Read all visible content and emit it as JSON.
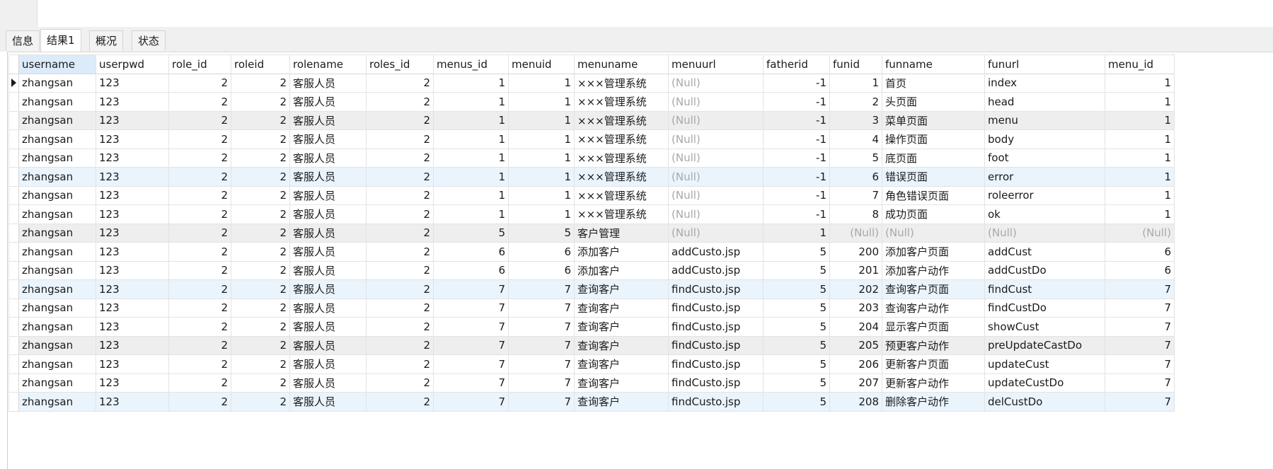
{
  "tabs": [
    {
      "label": "信息"
    },
    {
      "label": "结果1"
    },
    {
      "label": "概况"
    },
    {
      "label": "状态"
    }
  ],
  "grid": {
    "columns": [
      "username",
      "userpwd",
      "role_id",
      "roleid",
      "rolename",
      "roles_id",
      "menus_id",
      "menuid",
      "menuname",
      "menuurl",
      "fatherid",
      "funid",
      "funname",
      "funurl",
      "menu_id"
    ],
    "numeric": [
      false,
      false,
      true,
      true,
      false,
      true,
      true,
      true,
      false,
      false,
      true,
      true,
      false,
      false,
      true
    ],
    "rows": [
      [
        "zhangsan",
        "123",
        "2",
        "2",
        "客服人员",
        "2",
        "1",
        "1",
        "×××管理系统",
        "(Null)",
        "-1",
        "1",
        "首页",
        "index",
        "1"
      ],
      [
        "zhangsan",
        "123",
        "2",
        "2",
        "客服人员",
        "2",
        "1",
        "1",
        "×××管理系统",
        "(Null)",
        "-1",
        "2",
        "头页面",
        "head",
        "1"
      ],
      [
        "zhangsan",
        "123",
        "2",
        "2",
        "客服人员",
        "2",
        "1",
        "1",
        "×××管理系统",
        "(Null)",
        "-1",
        "3",
        "菜单页面",
        "menu",
        "1"
      ],
      [
        "zhangsan",
        "123",
        "2",
        "2",
        "客服人员",
        "2",
        "1",
        "1",
        "×××管理系统",
        "(Null)",
        "-1",
        "4",
        "操作页面",
        "body",
        "1"
      ],
      [
        "zhangsan",
        "123",
        "2",
        "2",
        "客服人员",
        "2",
        "1",
        "1",
        "×××管理系统",
        "(Null)",
        "-1",
        "5",
        "底页面",
        "foot",
        "1"
      ],
      [
        "zhangsan",
        "123",
        "2",
        "2",
        "客服人员",
        "2",
        "1",
        "1",
        "×××管理系统",
        "(Null)",
        "-1",
        "6",
        "错误页面",
        "error",
        "1"
      ],
      [
        "zhangsan",
        "123",
        "2",
        "2",
        "客服人员",
        "2",
        "1",
        "1",
        "×××管理系统",
        "(Null)",
        "-1",
        "7",
        "角色错误页面",
        "roleerror",
        "1"
      ],
      [
        "zhangsan",
        "123",
        "2",
        "2",
        "客服人员",
        "2",
        "1",
        "1",
        "×××管理系统",
        "(Null)",
        "-1",
        "8",
        "成功页面",
        "ok",
        "1"
      ],
      [
        "zhangsan",
        "123",
        "2",
        "2",
        "客服人员",
        "2",
        "5",
        "5",
        "客户管理",
        "(Null)",
        "1",
        "(Null)",
        "(Null)",
        "(Null)",
        "(Null)"
      ],
      [
        "zhangsan",
        "123",
        "2",
        "2",
        "客服人员",
        "2",
        "6",
        "6",
        "添加客户",
        "addCusto.jsp",
        "5",
        "200",
        "添加客户页面",
        "addCust",
        "6"
      ],
      [
        "zhangsan",
        "123",
        "2",
        "2",
        "客服人员",
        "2",
        "6",
        "6",
        "添加客户",
        "addCusto.jsp",
        "5",
        "201",
        "添加客户动作",
        "addCustDo",
        "6"
      ],
      [
        "zhangsan",
        "123",
        "2",
        "2",
        "客服人员",
        "2",
        "7",
        "7",
        "查询客户",
        "findCusto.jsp",
        "5",
        "202",
        "查询客户页面",
        "findCust",
        "7"
      ],
      [
        "zhangsan",
        "123",
        "2",
        "2",
        "客服人员",
        "2",
        "7",
        "7",
        "查询客户",
        "findCusto.jsp",
        "5",
        "203",
        "查询客户动作",
        "findCustDo",
        "7"
      ],
      [
        "zhangsan",
        "123",
        "2",
        "2",
        "客服人员",
        "2",
        "7",
        "7",
        "查询客户",
        "findCusto.jsp",
        "5",
        "204",
        "显示客户页面",
        "showCust",
        "7"
      ],
      [
        "zhangsan",
        "123",
        "2",
        "2",
        "客服人员",
        "2",
        "7",
        "7",
        "查询客户",
        "findCusto.jsp",
        "5",
        "205",
        "预更客户动作",
        "preUpdateCastDo",
        "7"
      ],
      [
        "zhangsan",
        "123",
        "2",
        "2",
        "客服人员",
        "2",
        "7",
        "7",
        "查询客户",
        "findCusto.jsp",
        "5",
        "206",
        "更新客户页面",
        "updateCust",
        "7"
      ],
      [
        "zhangsan",
        "123",
        "2",
        "2",
        "客服人员",
        "2",
        "7",
        "7",
        "查询客户",
        "findCusto.jsp",
        "5",
        "207",
        "更新客户动作",
        "updateCustDo",
        "7"
      ],
      [
        "zhangsan",
        "123",
        "2",
        "2",
        "客服人员",
        "2",
        "7",
        "7",
        "查询客户",
        "findCusto.jsp",
        "5",
        "208",
        "删除客户动作",
        "delCustDo",
        "7"
      ]
    ]
  }
}
